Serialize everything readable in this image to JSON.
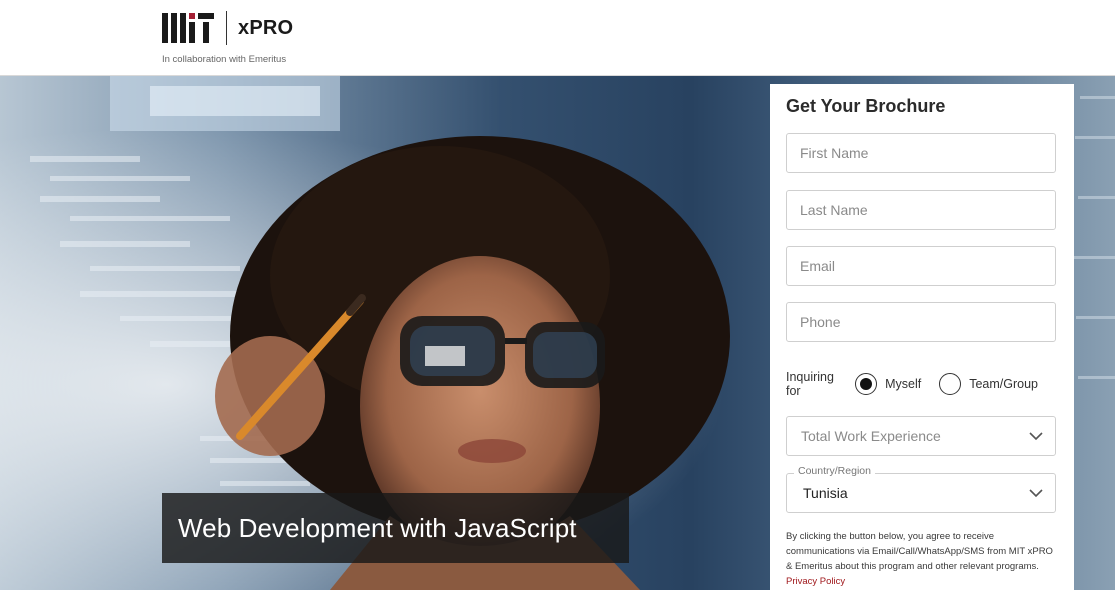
{
  "header": {
    "logo_wordmark": "MIT",
    "product": "xPRO",
    "collaboration": "In collaboration with Emeritus"
  },
  "hero": {
    "course_title": "Web Development with JavaScript"
  },
  "form": {
    "title": "Get Your Brochure",
    "first_name_placeholder": "First Name",
    "last_name_placeholder": "Last Name",
    "email_placeholder": "Email",
    "phone_placeholder": "Phone",
    "inquiring_label": "Inquiring for",
    "option_myself": "Myself",
    "option_team": "Team/Group",
    "selected_option": "Myself",
    "work_experience_placeholder": "Total Work Experience",
    "country_label": "Country/Region",
    "country_value": "Tunisia",
    "consent_text": "By clicking the button below, you agree to receive communications via Email/Call/WhatsApp/SMS from MIT xPRO & Emeritus about this program and other relevant programs.",
    "privacy_link": "Privacy Policy"
  },
  "colors": {
    "link": "#a0191d",
    "title_box": "#181818"
  }
}
